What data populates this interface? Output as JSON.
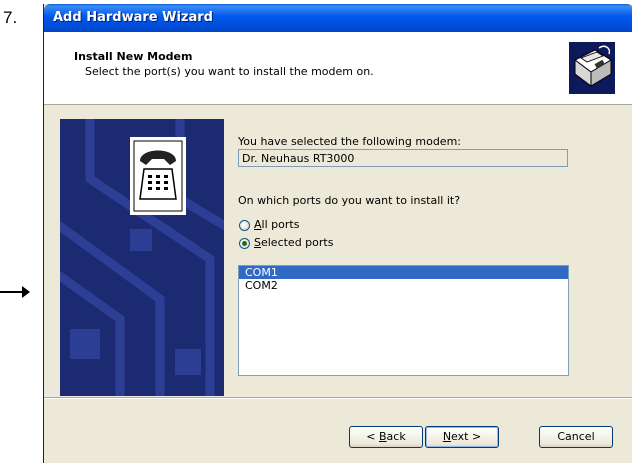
{
  "step": "7.",
  "window": {
    "title": "Add Hardware Wizard"
  },
  "header": {
    "title": "Install New Modem",
    "subtitle": "Select the port(s) you want to install the modem on.",
    "icon": "hardware-wizard-icon"
  },
  "main": {
    "selected_label": "You have selected the following modem:",
    "modem_name": "Dr. Neuhaus RT3000",
    "ports_question": "On which ports do you want to install it?",
    "radio_all": {
      "mnemonic": "A",
      "rest": "ll ports",
      "checked": false
    },
    "radio_selected": {
      "mnemonic": "S",
      "rest": "elected ports",
      "checked": true
    },
    "ports": [
      {
        "label": "COM1",
        "selected": true
      },
      {
        "label": "COM2",
        "selected": false
      }
    ]
  },
  "footer": {
    "back": {
      "pre": "< ",
      "mnemonic": "B",
      "post": "ack"
    },
    "next": {
      "mnemonic": "N",
      "post": "ext >"
    },
    "cancel": "Cancel"
  },
  "colors": {
    "titlebar": "#0058ee",
    "selection": "#316ac5",
    "face": "#ece9d8",
    "banner": "#1c2a72"
  }
}
